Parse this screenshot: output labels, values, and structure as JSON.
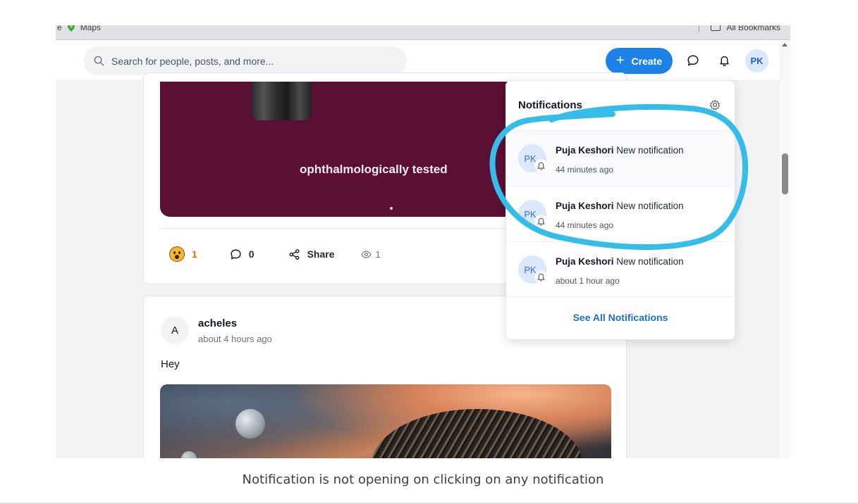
{
  "bookmarks": {
    "left_items": [
      "e",
      "Maps"
    ],
    "right_label": "All Bookmarks"
  },
  "header": {
    "search_placeholder": "Search for people, posts, and more...",
    "create_label": "Create",
    "avatar_initials": "PK"
  },
  "post1": {
    "image_caption": "ophthalmologically tested",
    "reaction_count": "1",
    "comment_count": "0",
    "share_label": "Share",
    "view_count": "1"
  },
  "post2": {
    "avatar_initial": "A",
    "author": "acheles",
    "time": "about 4 hours ago",
    "text": "Hey"
  },
  "notifications": {
    "title": "Notifications",
    "items": [
      {
        "initials": "PK",
        "name": "Puja Keshori",
        "message": "New notification",
        "time": "44 minutes ago"
      },
      {
        "initials": "PK",
        "name": "Puja Keshori",
        "message": "New notification",
        "time": "44 minutes ago"
      },
      {
        "initials": "PK",
        "name": "Puja Keshori",
        "message": "New notification",
        "time": "about 1 hour ago"
      }
    ],
    "see_all_label": "See All Notifications"
  },
  "annotation": {
    "color": "#33bde8"
  },
  "caption": "Notification is not opening on clicking on any notification"
}
